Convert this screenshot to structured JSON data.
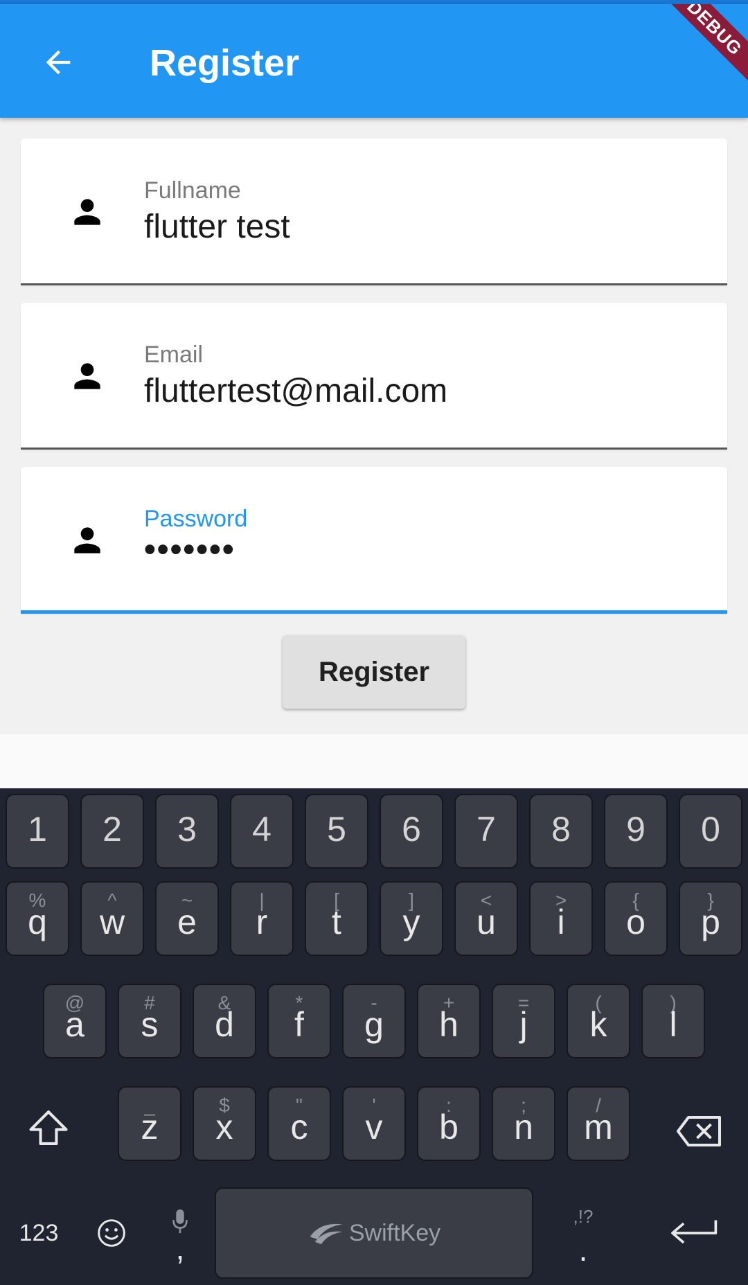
{
  "appbar": {
    "title": "Register",
    "debug_banner": "DEBUG"
  },
  "form": {
    "fullname": {
      "label": "Fullname",
      "value": "flutter test"
    },
    "email": {
      "label": "Email",
      "value": "fluttertest@mail.com"
    },
    "password": {
      "label": "Password",
      "value": "•••••••"
    },
    "submit_label": "Register"
  },
  "colors": {
    "appbar": "#2196f3",
    "focus": "#2196f3",
    "keyboard_bg": "#1f2430",
    "key_bg": "#3a3d45"
  },
  "keyboard": {
    "number_row": [
      "1",
      "2",
      "3",
      "4",
      "5",
      "6",
      "7",
      "8",
      "9",
      "0"
    ],
    "row1": [
      {
        "main": "q",
        "sub": "%"
      },
      {
        "main": "w",
        "sub": "^"
      },
      {
        "main": "e",
        "sub": "~"
      },
      {
        "main": "r",
        "sub": "|"
      },
      {
        "main": "t",
        "sub": "["
      },
      {
        "main": "y",
        "sub": "]"
      },
      {
        "main": "u",
        "sub": "<"
      },
      {
        "main": "i",
        "sub": ">"
      },
      {
        "main": "o",
        "sub": "{"
      },
      {
        "main": "p",
        "sub": "}"
      }
    ],
    "row2": [
      {
        "main": "a",
        "sub": "@"
      },
      {
        "main": "s",
        "sub": "#"
      },
      {
        "main": "d",
        "sub": "&"
      },
      {
        "main": "f",
        "sub": "*"
      },
      {
        "main": "g",
        "sub": "-"
      },
      {
        "main": "h",
        "sub": "+"
      },
      {
        "main": "j",
        "sub": "="
      },
      {
        "main": "k",
        "sub": "("
      },
      {
        "main": "l",
        "sub": ")"
      }
    ],
    "row3": [
      {
        "main": "z",
        "sub": "_"
      },
      {
        "main": "x",
        "sub": "$"
      },
      {
        "main": "c",
        "sub": "\""
      },
      {
        "main": "v",
        "sub": "'"
      },
      {
        "main": "b",
        "sub": ":"
      },
      {
        "main": "n",
        "sub": ";"
      },
      {
        "main": "m",
        "sub": "/"
      }
    ],
    "mode_label": "123",
    "comma": ",",
    "period": ".",
    "punct_hint": ",!?",
    "space_label": "SwiftKey",
    "icons": [
      "shift-icon",
      "backspace-icon",
      "emoji-icon",
      "mic-icon",
      "enter-icon"
    ]
  }
}
